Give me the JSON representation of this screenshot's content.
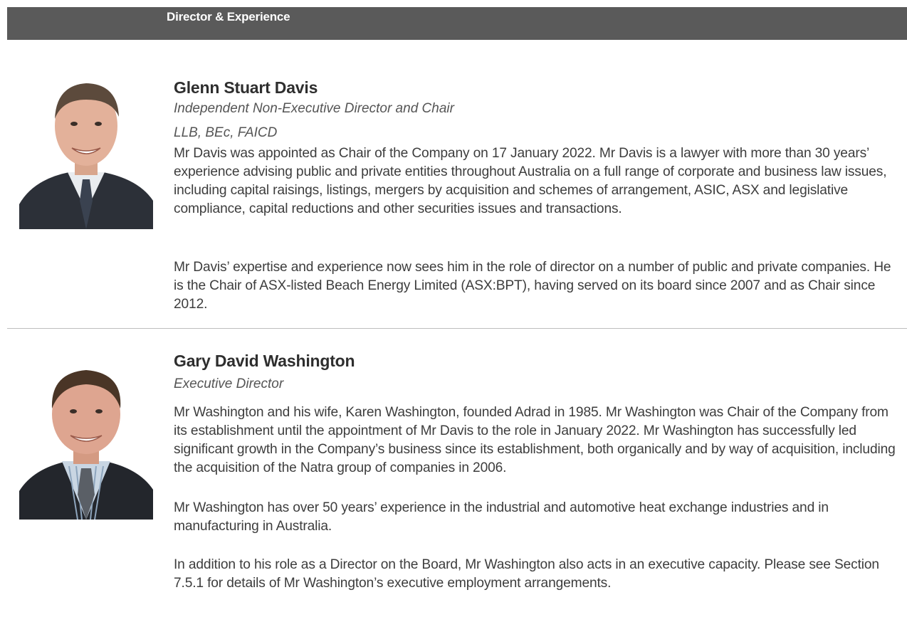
{
  "section": {
    "title": "Director & Experience"
  },
  "directors": [
    {
      "name": "Glenn Stuart Davis",
      "role": "Independent Non-Executive Director and Chair",
      "qualifications": "LLB, BEc, FAICD",
      "paragraphs": [
        "Mr Davis was appointed as Chair of the Company on 17 January 2022. Mr Davis is a lawyer with more than 30 years’ experience advising public and private entities throughout Australia on a full range of corporate and business law issues, including capital raisings, listings, mergers by acquisition and schemes of arrangement, ASIC, ASX and legislative compliance, capital reductions and other securities issues and transactions.",
        "Mr Davis’ expertise and experience now sees him in the role of director on a number of public and private companies. He is the Chair of ASX-listed Beach Energy Limited (ASX:BPT), having served on its board since 2007 and as Chair since 2012."
      ]
    },
    {
      "name": "Gary David Washington",
      "role": "Executive Director",
      "paragraphs": [
        "Mr Washington and his wife, Karen Washington, founded Adrad in 1985. Mr Washington was Chair of the Company from its establishment until the appointment of Mr Davis to the role in January 2022. Mr Washington has successfully led significant growth in the Company’s business since its establishment, both organically and by way of acquisition, including the acquisition of the Natra group of companies in 2006.",
        "Mr Washington has over 50 years’ experience in the industrial and automotive heat exchange industries and in manufacturing in Australia.",
        "In addition to his role as a Director on the Board, Mr Washington also acts in an executive capacity. Please see Section 7.5.1 for details of Mr Washington’s executive employment arrangements."
      ]
    }
  ]
}
